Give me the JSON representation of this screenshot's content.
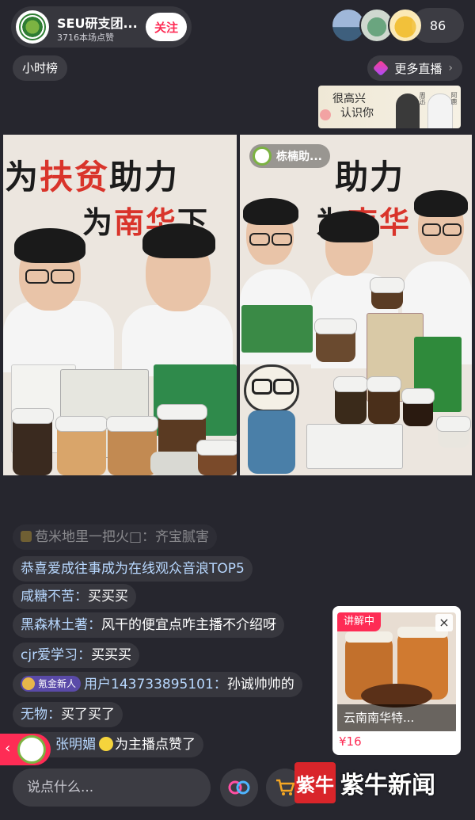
{
  "header": {
    "host_name": "SEU研支团...",
    "host_likes": "3716本场点赞",
    "follow_label": "关注",
    "viewer_count": "86"
  },
  "hour_rank_label": "小时榜",
  "more_live_label": "更多直播",
  "banner": {
    "text_line1": "很高兴",
    "text_line2": "认识你",
    "name1": "周迅",
    "name2": "阿鹿"
  },
  "video_left": {
    "slogan_pre": "为",
    "slogan_red": "扶贫",
    "slogan_post": "助力",
    "slogan2_pre": "为",
    "slogan2_red": "南华",
    "slogan2_post": "下"
  },
  "video_right": {
    "guest_label": "栋楠助...",
    "slogan_post": "助力",
    "slogan2_pre": "为",
    "slogan2_red": "南华"
  },
  "chat": [
    {
      "user": "",
      "text": "苞米地里一把火□：齐宝腻害"
    },
    {
      "user": "",
      "text": "恭喜爱成往事成为在线观众音浪TOP5"
    },
    {
      "user": "咸糖不苦：",
      "text": "买买买"
    },
    {
      "user": "黑森林土著：",
      "text": "风干的便宜点咋主播不介绍呀"
    },
    {
      "user": "cjr爱学习：",
      "text": "买买买"
    },
    {
      "badge": "氪金新人",
      "user": "用户143733895101：",
      "text": "孙诚帅帅的"
    },
    {
      "user": "无物：",
      "text": "买了买了"
    },
    {
      "user": "张明媚",
      "text": "为主播点赞了"
    }
  ],
  "product": {
    "badge": "讲解中",
    "close": "×",
    "caption": "云南南华特...",
    "price": "¥16"
  },
  "bottom": {
    "input_placeholder": "说点什么...",
    "watermark_logo": "紫牛",
    "watermark_text": "紫牛新闻"
  }
}
